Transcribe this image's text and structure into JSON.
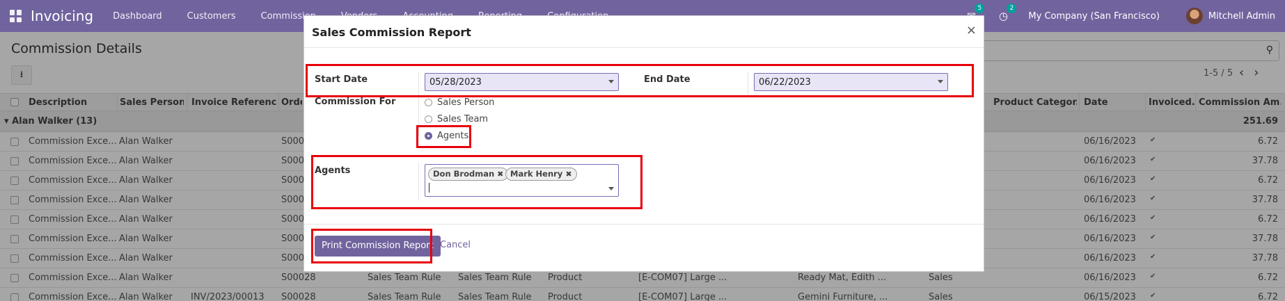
{
  "navbar": {
    "app_name": "Invoicing",
    "menu": [
      "Dashboard",
      "Customers",
      "Commission",
      "Vendors",
      "Accounting",
      "Reporting",
      "Configuration"
    ],
    "messages_count": "5",
    "activities_count": "2",
    "company": "My Company (San Francisco)",
    "user": "Mitchell Admin"
  },
  "control_panel": {
    "title": "Commission Details",
    "pager": "1-5 / 5"
  },
  "table": {
    "columns": [
      "Description",
      "Sales Person",
      "Invoice Referenc...",
      "Orde",
      "Product Categor...",
      "Date",
      "Invoiced...",
      "Commission Am..."
    ],
    "group": {
      "label": "Alan Walker (13)",
      "total": "251.69"
    },
    "rows": [
      {
        "desc": "Commission Exce...",
        "person": "Alan Walker",
        "inv": "",
        "order": "S000",
        "a": "",
        "b": "",
        "c": "",
        "d": "",
        "e": "",
        "f": "",
        "date": "06/16/2023",
        "amount": "6.72"
      },
      {
        "desc": "Commission Exce...",
        "person": "Alan Walker",
        "inv": "",
        "order": "S000",
        "a": "",
        "b": "",
        "c": "",
        "d": "",
        "e": "",
        "f": "",
        "date": "06/16/2023",
        "amount": "37.78"
      },
      {
        "desc": "Commission Exce...",
        "person": "Alan Walker",
        "inv": "",
        "order": "S000",
        "a": "",
        "b": "",
        "c": "",
        "d": "",
        "e": "",
        "f": "",
        "date": "06/16/2023",
        "amount": "6.72"
      },
      {
        "desc": "Commission Exce...",
        "person": "Alan Walker",
        "inv": "",
        "order": "S000",
        "a": "",
        "b": "",
        "c": "",
        "d": "",
        "e": "",
        "f": "",
        "date": "06/16/2023",
        "amount": "37.78"
      },
      {
        "desc": "Commission Exce...",
        "person": "Alan Walker",
        "inv": "",
        "order": "S000",
        "a": "",
        "b": "",
        "c": "",
        "d": "",
        "e": "",
        "f": "",
        "date": "06/16/2023",
        "amount": "6.72"
      },
      {
        "desc": "Commission Exce...",
        "person": "Alan Walker",
        "inv": "",
        "order": "S000",
        "a": "",
        "b": "",
        "c": "",
        "d": "",
        "e": "",
        "f": "",
        "date": "06/16/2023",
        "amount": "37.78"
      },
      {
        "desc": "Commission Exce...",
        "person": "Alan Walker",
        "inv": "",
        "order": "S000",
        "a": "",
        "b": "",
        "c": "",
        "d": "",
        "e": "",
        "f": "",
        "date": "06/16/2023",
        "amount": "37.78"
      },
      {
        "desc": "Commission Exce...",
        "person": "Alan Walker",
        "inv": "",
        "order": "S00028",
        "a": "Sales Team Rule",
        "b": "Sales Team Rule",
        "c": "Product",
        "d": "[E-COM07] Large ...",
        "e": "Ready Mat, Edith ...",
        "f": "Sales",
        "date": "06/16/2023",
        "amount": "6.72"
      },
      {
        "desc": "Commission Exce...",
        "person": "Alan Walker",
        "inv": "INV/2023/00013",
        "order": "S00028",
        "a": "Sales Team Rule",
        "b": "Sales Team Rule",
        "c": "Product",
        "d": "[E-COM07] Large ...",
        "e": "Gemini Furniture, ...",
        "f": "Sales",
        "date": "06/15/2023",
        "amount": "6.72"
      }
    ]
  },
  "modal": {
    "title": "Sales Commission Report",
    "close_symbol": "×",
    "start_date_label": "Start Date",
    "start_date": "05/28/2023",
    "end_date_label": "End Date",
    "end_date": "06/22/2023",
    "commission_for_label": "Commission For",
    "options": [
      "Sales Person",
      "Sales Team",
      "Agents"
    ],
    "selected_option": "Agents",
    "agents_label": "Agents",
    "agents": [
      "Don Brodman",
      "Mark Henry"
    ],
    "print_button": "Print Commission Report",
    "cancel_button": "Cancel"
  },
  "colors": {
    "brand": "#71639e",
    "highlight": "#e8000a"
  }
}
